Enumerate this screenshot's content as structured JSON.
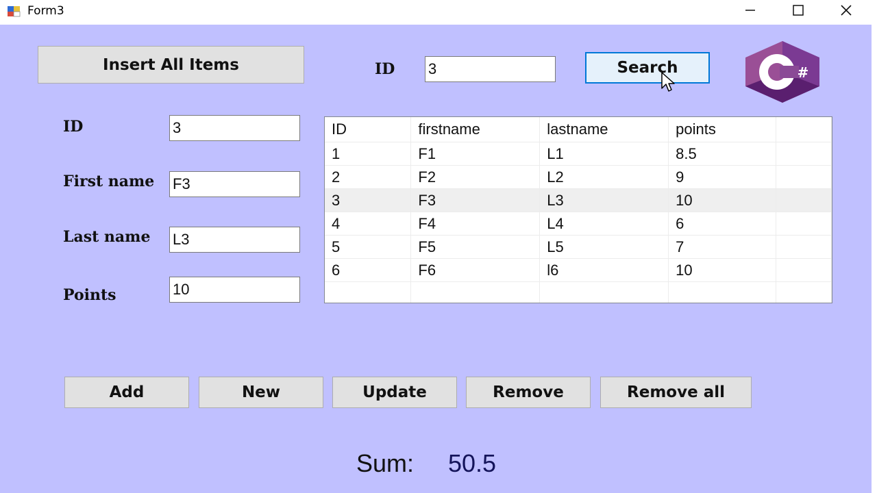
{
  "window": {
    "title": "Form3"
  },
  "top": {
    "insert_all_label": "Insert All Items",
    "search_id_label": "ID",
    "search_id_value": "3",
    "search_label": "Search",
    "logo_text": "C#"
  },
  "fields": {
    "id_label": "ID",
    "id_value": "3",
    "firstname_label": "First name",
    "firstname_value": "F3",
    "lastname_label": "Last name",
    "lastname_value": "L3",
    "points_label": "Points",
    "points_value": "10"
  },
  "table": {
    "columns": [
      "ID",
      "firstname",
      "lastname",
      "points"
    ],
    "rows": [
      [
        "1",
        "F1",
        "L1",
        "8.5"
      ],
      [
        "2",
        "F2",
        "L2",
        "9"
      ],
      [
        "3",
        "F3",
        "L3",
        "10"
      ],
      [
        "4",
        "F4",
        "L4",
        "6"
      ],
      [
        "5",
        "F5",
        "L5",
        "7"
      ],
      [
        "6",
        "F6",
        "l6",
        "10"
      ]
    ],
    "selected_row": 2
  },
  "actions": {
    "add": "Add",
    "new": "New",
    "update": "Update",
    "remove": "Remove",
    "remove_all": "Remove all"
  },
  "sum": {
    "label": "Sum:",
    "value": "50.5"
  },
  "colors": {
    "form_background": "#c0c0ff",
    "button_face": "#e1e1e1",
    "focus_border": "#0078d7",
    "csharp_purple": "#68217a"
  },
  "icons": [
    "app-icon",
    "minimize-icon",
    "maximize-icon",
    "close-icon",
    "csharp-logo",
    "mouse-cursor-icon"
  ]
}
